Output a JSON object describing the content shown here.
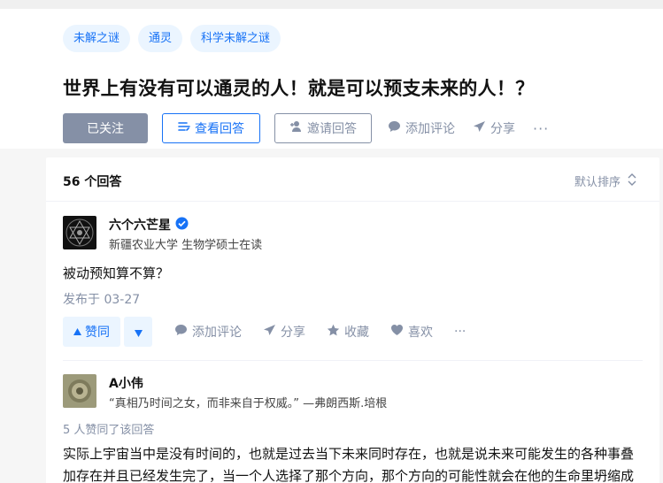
{
  "question": {
    "tags": [
      "未解之谜",
      "通灵",
      "科学未解之谜"
    ],
    "title": "世界上有没有可以通灵的人！就是可以预支未来的人！？",
    "actions": {
      "followed": "已关注",
      "view_answers": "查看回答",
      "invite": "邀请回答",
      "add_comment": "添加评论",
      "share": "分享",
      "more": "···"
    }
  },
  "answers_panel": {
    "count_label": "56 个回答",
    "sort_label": "默认排序"
  },
  "answers": [
    {
      "author": "六个六芒星",
      "verified": true,
      "bio": "新疆农业大学 生物学硕士在读",
      "content": "被动预知算不算？",
      "date": "发布于 03-27",
      "actions": {
        "upvote": "赞同",
        "add_comment": "添加评论",
        "share": "分享",
        "collect": "收藏",
        "like": "喜欢",
        "more": "···"
      }
    },
    {
      "author": "A小伟",
      "bio": "“真相乃时间之女，而非来自于权威。” —弗朗西斯.培根",
      "votes": "5 人赞同了该回答",
      "content_lines": [
        "实际上宇宙当中是没有时间的，也就是过去当下未来同时存在，也就是说未来可能发生的各种事叠",
        "加存在并且已经发生完了，当一个人选择了那个方向，那个方向的可能性就会在他的生命里坍缩成"
      ]
    }
  ],
  "colors": {
    "brand_blue": "#1772f6",
    "tag_bg": "#ebf5ff",
    "muted": "#8590a6",
    "page_bg": "#f6f6f6"
  }
}
